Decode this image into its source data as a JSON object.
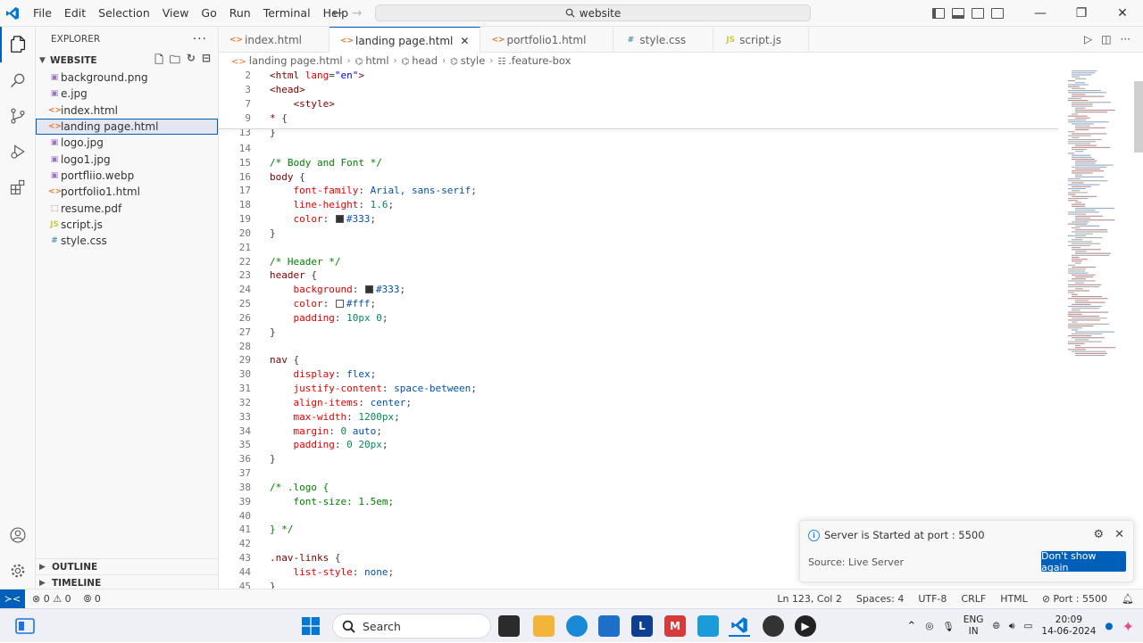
{
  "window": {
    "search_text": "website",
    "menu": [
      "File",
      "Edit",
      "Selection",
      "View",
      "Go",
      "Run",
      "Terminal",
      "Help"
    ]
  },
  "sidebar": {
    "title": "EXPLORER",
    "folder": "WEBSITE",
    "files": [
      {
        "name": "background.png",
        "icon": "img"
      },
      {
        "name": "e.jpg",
        "icon": "img"
      },
      {
        "name": "index.html",
        "icon": "html"
      },
      {
        "name": "landing page.html",
        "icon": "html",
        "active": true
      },
      {
        "name": "logo.jpg",
        "icon": "img"
      },
      {
        "name": "logo1.jpg",
        "icon": "img"
      },
      {
        "name": "portfliio.webp",
        "icon": "img"
      },
      {
        "name": "portfolio1.html",
        "icon": "html"
      },
      {
        "name": "resume.pdf",
        "icon": "pdf"
      },
      {
        "name": "script.js",
        "icon": "js"
      },
      {
        "name": "style.css",
        "icon": "css"
      }
    ],
    "outline_label": "OUTLINE",
    "timeline_label": "TIMELINE"
  },
  "tabs": [
    {
      "label": "index.html",
      "icon": "html"
    },
    {
      "label": "landing page.html",
      "icon": "html",
      "active": true
    },
    {
      "label": "portfolio1.html",
      "icon": "html"
    },
    {
      "label": "style.css",
      "icon": "css"
    },
    {
      "label": "script.js",
      "icon": "js"
    }
  ],
  "breadcrumb": [
    "landing page.html",
    "html",
    "head",
    "style",
    ".feature-box"
  ],
  "code": [
    {
      "n": "2",
      "t": [
        [
          "t-tag",
          "<html "
        ],
        [
          "t-attr",
          "lang"
        ],
        [
          "",
          "="
        ],
        [
          "t-str",
          "\"en\""
        ],
        [
          "t-tag",
          ">"
        ]
      ]
    },
    {
      "n": "3",
      "t": [
        [
          "t-tag",
          "<head>"
        ]
      ]
    },
    {
      "n": "7",
      "t": [
        [
          "",
          "    "
        ],
        [
          "t-tag",
          "<style>"
        ]
      ]
    },
    {
      "n": "9",
      "t": [
        [
          "t-sel",
          "* "
        ],
        [
          "",
          "{"
        ]
      ]
    },
    {
      "n": "13",
      "t": [
        [
          "",
          "}"
        ]
      ]
    },
    {
      "n": "14",
      "t": []
    },
    {
      "n": "15",
      "t": [
        [
          "t-com",
          "/* Body and Font */"
        ]
      ]
    },
    {
      "n": "16",
      "t": [
        [
          "t-sel",
          "body "
        ],
        [
          "",
          "{"
        ]
      ]
    },
    {
      "n": "17",
      "t": [
        [
          "",
          "    "
        ],
        [
          "t-prop",
          "font-family"
        ],
        [
          "",
          ": "
        ],
        [
          "t-val",
          "Arial, sans-serif"
        ],
        [
          "",
          ";"
        ]
      ]
    },
    {
      "n": "18",
      "t": [
        [
          "",
          "    "
        ],
        [
          "t-prop",
          "line-height"
        ],
        [
          "",
          ": "
        ],
        [
          "t-num",
          "1.6"
        ],
        [
          "",
          ";"
        ]
      ]
    },
    {
      "n": "19",
      "t": [
        [
          "",
          "    "
        ],
        [
          "t-prop",
          "color"
        ],
        [
          "",
          ": "
        ],
        [
          "swatch",
          "#333333"
        ],
        [
          "t-val",
          "#333"
        ],
        [
          "",
          ";"
        ]
      ]
    },
    {
      "n": "20",
      "t": [
        [
          "",
          "}"
        ]
      ]
    },
    {
      "n": "21",
      "t": []
    },
    {
      "n": "22",
      "t": [
        [
          "t-com",
          "/* Header */"
        ]
      ]
    },
    {
      "n": "23",
      "t": [
        [
          "t-sel",
          "header "
        ],
        [
          "",
          "{"
        ]
      ]
    },
    {
      "n": "24",
      "t": [
        [
          "",
          "    "
        ],
        [
          "t-prop",
          "background"
        ],
        [
          "",
          ": "
        ],
        [
          "swatch",
          "#333333"
        ],
        [
          "t-val",
          "#333"
        ],
        [
          "",
          ";"
        ]
      ]
    },
    {
      "n": "25",
      "t": [
        [
          "",
          "    "
        ],
        [
          "t-prop",
          "color"
        ],
        [
          "",
          ": "
        ],
        [
          "swatch",
          "#ffffff"
        ],
        [
          "t-val",
          "#fff"
        ],
        [
          "",
          ";"
        ]
      ]
    },
    {
      "n": "26",
      "t": [
        [
          "",
          "    "
        ],
        [
          "t-prop",
          "padding"
        ],
        [
          "",
          ": "
        ],
        [
          "t-num",
          "10px 0"
        ],
        [
          "",
          ";"
        ]
      ]
    },
    {
      "n": "27",
      "t": [
        [
          "",
          "}"
        ]
      ]
    },
    {
      "n": "28",
      "t": []
    },
    {
      "n": "29",
      "t": [
        [
          "t-sel",
          "nav "
        ],
        [
          "",
          "{"
        ]
      ]
    },
    {
      "n": "30",
      "t": [
        [
          "",
          "    "
        ],
        [
          "t-prop",
          "display"
        ],
        [
          "",
          ": "
        ],
        [
          "t-val",
          "flex"
        ],
        [
          "",
          ";"
        ]
      ]
    },
    {
      "n": "31",
      "t": [
        [
          "",
          "    "
        ],
        [
          "t-prop",
          "justify-content"
        ],
        [
          "",
          ": "
        ],
        [
          "t-val",
          "space-between"
        ],
        [
          "",
          ";"
        ]
      ]
    },
    {
      "n": "32",
      "t": [
        [
          "",
          "    "
        ],
        [
          "t-prop",
          "align-items"
        ],
        [
          "",
          ": "
        ],
        [
          "t-val",
          "center"
        ],
        [
          "",
          ";"
        ]
      ]
    },
    {
      "n": "33",
      "t": [
        [
          "",
          "    "
        ],
        [
          "t-prop",
          "max-width"
        ],
        [
          "",
          ": "
        ],
        [
          "t-num",
          "1200px"
        ],
        [
          "",
          ";"
        ]
      ]
    },
    {
      "n": "34",
      "t": [
        [
          "",
          "    "
        ],
        [
          "t-prop",
          "margin"
        ],
        [
          "",
          ": "
        ],
        [
          "t-num",
          "0 "
        ],
        [
          "t-val",
          "auto"
        ],
        [
          "",
          ";"
        ]
      ]
    },
    {
      "n": "35",
      "t": [
        [
          "",
          "    "
        ],
        [
          "t-prop",
          "padding"
        ],
        [
          "",
          ": "
        ],
        [
          "t-num",
          "0 20px"
        ],
        [
          "",
          ";"
        ]
      ]
    },
    {
      "n": "36",
      "t": [
        [
          "",
          "}"
        ]
      ]
    },
    {
      "n": "37",
      "t": []
    },
    {
      "n": "38",
      "t": [
        [
          "t-com",
          "/* .logo {"
        ]
      ]
    },
    {
      "n": "39",
      "t": [
        [
          "t-com",
          "    font-size: 1.5em;"
        ]
      ]
    },
    {
      "n": "40",
      "t": []
    },
    {
      "n": "41",
      "t": [
        [
          "t-com",
          "} */"
        ]
      ]
    },
    {
      "n": "42",
      "t": []
    },
    {
      "n": "43",
      "t": [
        [
          "t-sel",
          ".nav-links "
        ],
        [
          "",
          "{"
        ]
      ]
    },
    {
      "n": "44",
      "t": [
        [
          "",
          "    "
        ],
        [
          "t-prop",
          "list-style"
        ],
        [
          "",
          ": "
        ],
        [
          "t-val",
          "none"
        ],
        [
          "",
          ";"
        ]
      ]
    },
    {
      "n": "45",
      "t": [
        [
          "",
          "}"
        ]
      ]
    }
  ],
  "notification": {
    "message": "Server is Started at port : 5500",
    "source": "Source: Live Server",
    "button": "Don't show again"
  },
  "statusbar": {
    "errors": "0",
    "warnings": "0",
    "ports": "0",
    "position": "Ln 123, Col 2",
    "spaces": "Spaces: 4",
    "encoding": "UTF-8",
    "eol": "CRLF",
    "language": "HTML",
    "port": "Port : 5500"
  },
  "taskbar": {
    "search": "Search",
    "lang_line1": "ENG",
    "lang_line2": "IN",
    "time": "20:09",
    "date": "14-06-2024"
  },
  "colors": {
    "accent": "#005fb8",
    "comment": "#008000",
    "selector": "#800000",
    "property": "#e50000",
    "value": "#0451a5",
    "number": "#098658"
  }
}
